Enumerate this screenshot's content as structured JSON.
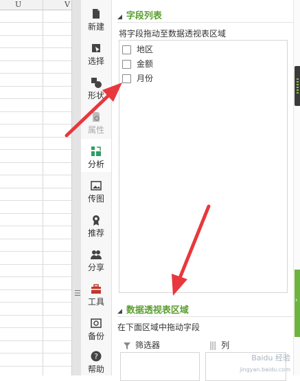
{
  "sheet": {
    "columns": [
      "U",
      "V"
    ]
  },
  "toolbar": {
    "items": [
      {
        "label": "新建",
        "icon": "new-doc-icon"
      },
      {
        "label": "选择",
        "icon": "select-cursor-icon"
      },
      {
        "label": "形状",
        "icon": "shapes-icon"
      },
      {
        "label": "属性",
        "icon": "properties-icon"
      },
      {
        "label": "分析",
        "icon": "pivot-analysis-icon"
      },
      {
        "label": "传图",
        "icon": "upload-image-icon"
      },
      {
        "label": "推荐",
        "icon": "recommend-badge-icon"
      },
      {
        "label": "分享",
        "icon": "share-people-icon"
      },
      {
        "label": "工具",
        "icon": "toolbox-icon"
      },
      {
        "label": "备份",
        "icon": "backup-icon"
      },
      {
        "label": "帮助",
        "icon": "help-icon"
      }
    ]
  },
  "panel": {
    "field_list_title": "字段列表",
    "field_list_hint": "将字段拖动至数据透视表区域",
    "fields": [
      {
        "label": "地区",
        "checked": false
      },
      {
        "label": "金额",
        "checked": false
      },
      {
        "label": "月份",
        "checked": false
      }
    ],
    "area_title": "数据透视表区域",
    "area_hint": "在下面区域中拖动字段",
    "filter_label": "筛选器",
    "column_label": "列"
  },
  "colors": {
    "accent_green": "#5a9e2f",
    "arrow_red": "#e8383d",
    "pivot_icon_green": "#2e9e62"
  },
  "watermark": {
    "line1": "Baidu 经验",
    "line2": "jingyan.baidu.com"
  }
}
